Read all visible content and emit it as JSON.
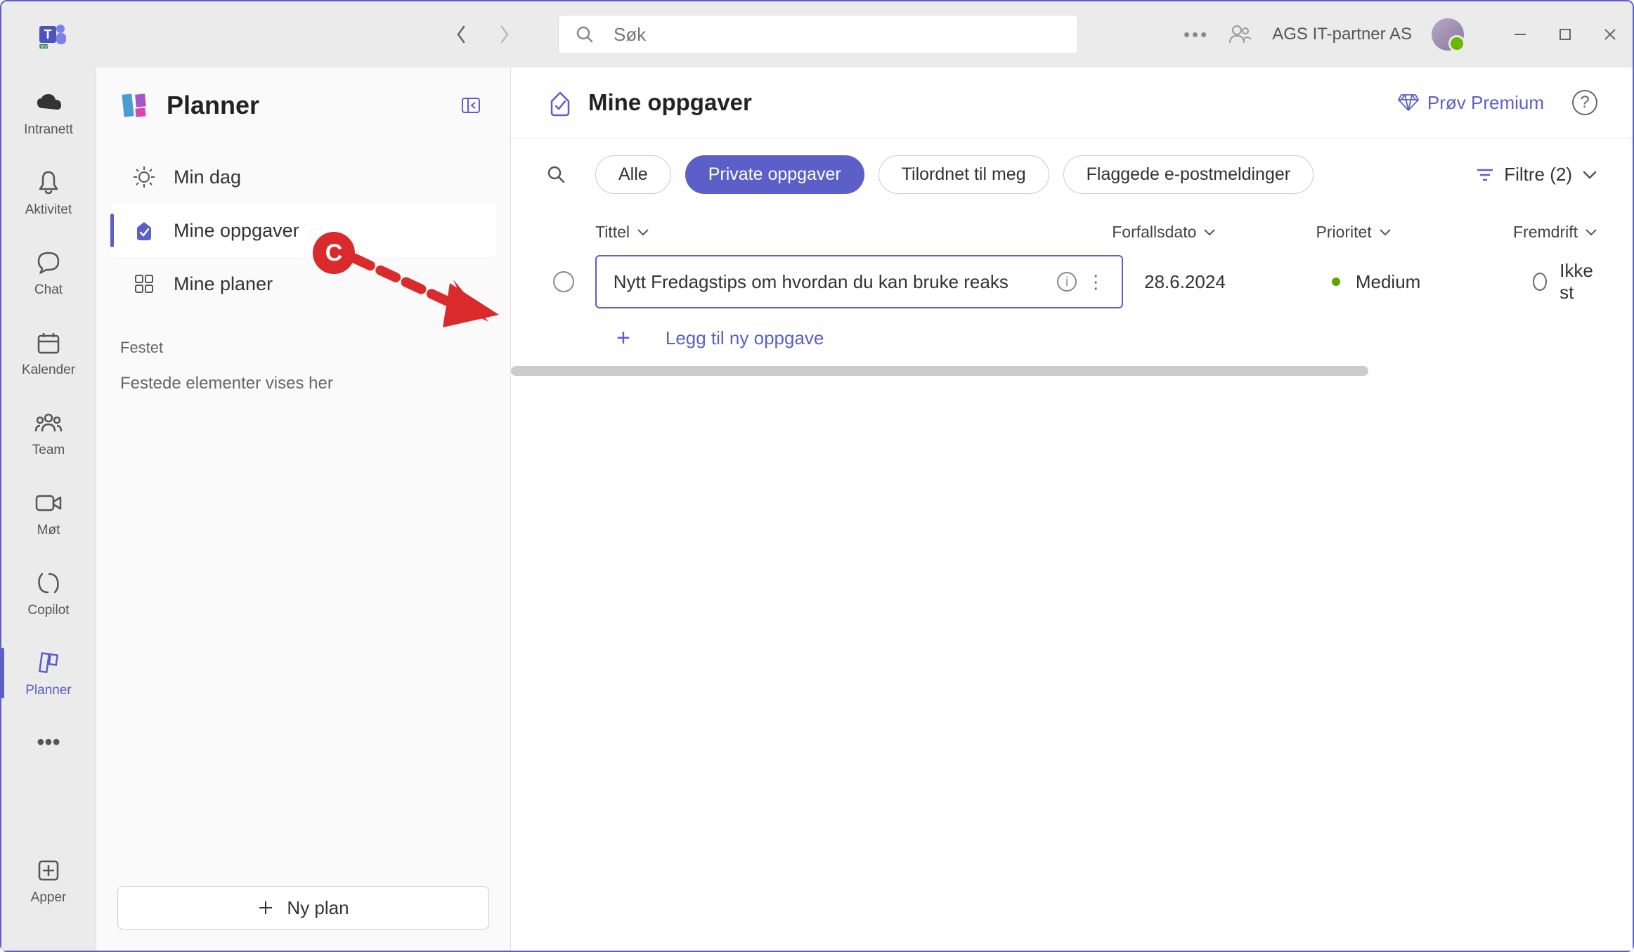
{
  "titlebar": {
    "search_placeholder": "Søk",
    "org": "AGS IT-partner AS"
  },
  "rail": {
    "items": [
      {
        "label": "Intranett"
      },
      {
        "label": "Aktivitet"
      },
      {
        "label": "Chat"
      },
      {
        "label": "Kalender"
      },
      {
        "label": "Team"
      },
      {
        "label": "Møt"
      },
      {
        "label": "Copilot"
      },
      {
        "label": "Planner"
      }
    ],
    "apper": "Apper"
  },
  "sidebar": {
    "title": "Planner",
    "nav": [
      {
        "label": "Min dag"
      },
      {
        "label": "Mine oppgaver"
      },
      {
        "label": "Mine planer"
      }
    ],
    "pinned_label": "Festet",
    "pinned_empty": "Festede elementer vises her",
    "new_plan": "Ny plan"
  },
  "main": {
    "title": "Mine oppgaver",
    "premium": "Prøv Premium",
    "pills": [
      {
        "label": "Alle"
      },
      {
        "label": "Private oppgaver"
      },
      {
        "label": "Tilordnet til meg"
      },
      {
        "label": "Flaggede e-postmeldinger"
      }
    ],
    "filter_label": "Filtre (2)",
    "columns": {
      "title": "Tittel",
      "due": "Forfallsdato",
      "priority": "Prioritet",
      "progress": "Fremdrift"
    },
    "tasks": [
      {
        "title": "Nytt Fredagstips om hvordan du kan bruke reaks",
        "due": "28.6.2024",
        "priority": "Medium",
        "progress": "Ikke st"
      }
    ],
    "add_task": "Legg til ny oppgave"
  },
  "overlay": {
    "badge": "C"
  }
}
